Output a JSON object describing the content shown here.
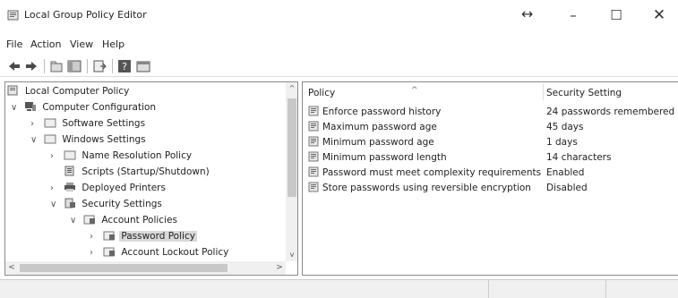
{
  "window": {
    "title": "Local Group Policy Editor",
    "resize_glyph": "↔",
    "minimize": "–",
    "maximize": "☐",
    "close": "✕"
  },
  "menu": [
    "File",
    "Action",
    "View",
    "Help"
  ],
  "toolbar": {
    "buttons": [
      "back-arrow-icon",
      "forward-arrow-icon",
      "up-folder-icon",
      "show-hide-tree-icon",
      "export-list-icon",
      "help-icon",
      "properties-icon"
    ]
  },
  "tree": {
    "items": [
      {
        "label": "Local Computer Policy",
        "chevron": "",
        "icon": "policy-computer-icon"
      },
      {
        "label": "Computer Configuration",
        "chevron": "∨",
        "icon": "computer-config-icon"
      },
      {
        "label": "Software Settings",
        "chevron": "›",
        "icon": "folder-icon"
      },
      {
        "label": "Windows Settings",
        "chevron": "∨",
        "icon": "folder-icon"
      },
      {
        "label": "Name Resolution Policy",
        "chevron": "›",
        "icon": "folder-icon"
      },
      {
        "label": "Scripts (Startup/Shutdown)",
        "chevron": "",
        "icon": "scripts-icon"
      },
      {
        "label": "Deployed Printers",
        "chevron": "›",
        "icon": "printer-icon"
      },
      {
        "label": "Security Settings",
        "chevron": "∨",
        "icon": "security-icon"
      },
      {
        "label": "Account Policies",
        "chevron": "∨",
        "icon": "policy-folder-icon"
      },
      {
        "label": "Password Policy",
        "chevron": "›",
        "icon": "policy-folder-icon",
        "selected": true
      },
      {
        "label": "Account Lockout Policy",
        "chevron": "›",
        "icon": "policy-folder-icon"
      }
    ],
    "scroll_up": "^",
    "scroll_down": "v",
    "scroll_left": "<",
    "scroll_right": ">"
  },
  "list": {
    "columns": [
      "Policy",
      "Security Setting"
    ],
    "sort_indicator": "^",
    "rows": [
      {
        "policy": "Enforce password history",
        "setting": "24 passwords remembered"
      },
      {
        "policy": "Maximum password age",
        "setting": "45 days"
      },
      {
        "policy": "Minimum password age",
        "setting": "1 days"
      },
      {
        "policy": "Minimum password length",
        "setting": "14 characters"
      },
      {
        "policy": "Password must meet complexity requirements",
        "setting": "Enabled"
      },
      {
        "policy": "Store passwords using reversible encryption",
        "setting": "Disabled"
      }
    ]
  }
}
